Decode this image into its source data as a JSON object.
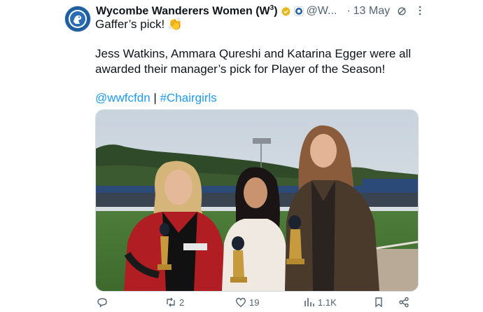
{
  "post": {
    "author_name": "Wycombe Wanderers Women (W",
    "author_sup": "3",
    "author_close": ")",
    "handle": "@W...",
    "separator": "·",
    "date": "13 May",
    "line1": "Gaffer’s pick! 👏",
    "line2": "Jess Watkins, Ammara Qureshi and Katarina Egger were all",
    "line3": "awarded their manager’s pick for Player of the Season!",
    "mention": "@wwfcfdn",
    "link_sep": "|",
    "hashtag": "#Chairgirls"
  },
  "actions": {
    "replies": "",
    "reposts": "2",
    "likes": "19",
    "views": "1.1K"
  },
  "colors": {
    "text": "#0f1419",
    "muted": "#536471",
    "link": "#1d9bf0",
    "verified_gold": "#e2b719",
    "club_blue": "#1f5fa0"
  },
  "icons": {
    "verified": "verified-badge-icon",
    "affiliate": "club-affiliate-badge-icon",
    "grok": "grok-icon",
    "more": "more-icon",
    "reply": "reply-icon",
    "repost": "repost-icon",
    "like": "like-icon",
    "views": "views-icon",
    "bookmark": "bookmark-icon",
    "share": "share-icon"
  }
}
